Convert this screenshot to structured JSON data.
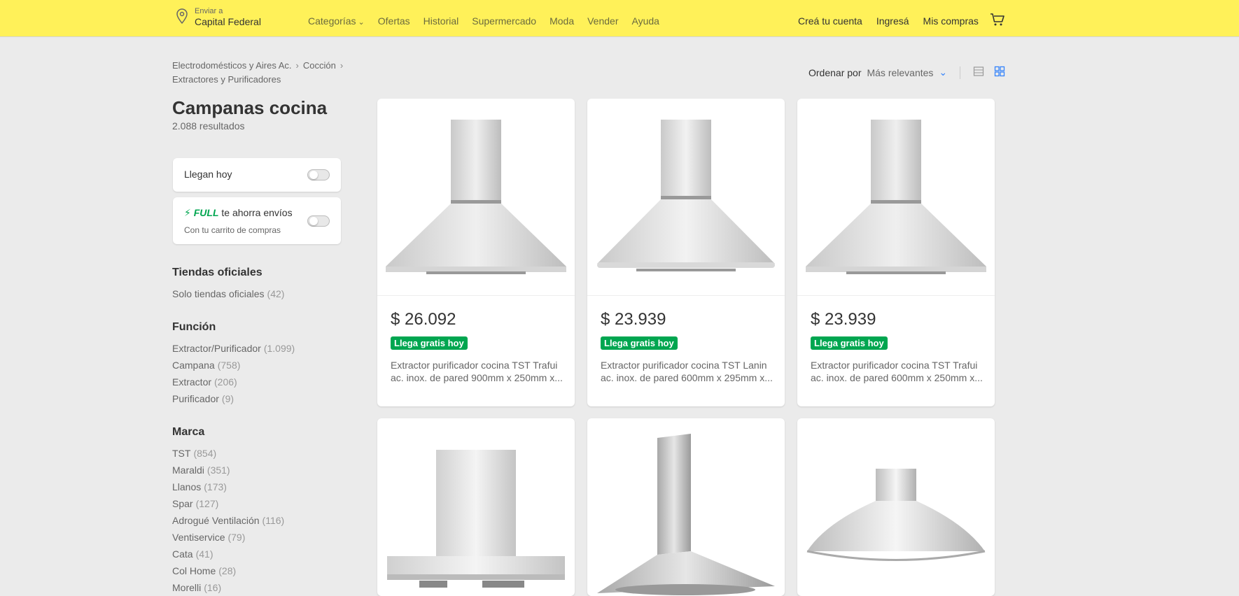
{
  "header": {
    "location_small": "Enviar a",
    "location_big": "Capital Federal",
    "nav": [
      "Categorías",
      "Ofertas",
      "Historial",
      "Supermercado",
      "Moda",
      "Vender",
      "Ayuda"
    ],
    "account": [
      "Creá tu cuenta",
      "Ingresá",
      "Mis compras"
    ]
  },
  "breadcrumbs": [
    "Electrodomésticos y Aires Ac.",
    "Cocción",
    "Extractores y Purificadores"
  ],
  "page": {
    "title": "Campanas cocina",
    "results": "2.088 resultados"
  },
  "filters": {
    "today": {
      "label": "Llegan hoy"
    },
    "full": {
      "brand": "FULL",
      "label": "te ahorra envíos",
      "sub": "Con tu carrito de compras"
    },
    "sections": [
      {
        "title": "Tiendas oficiales",
        "items": [
          {
            "label": "Solo tiendas oficiales",
            "count": "(42)"
          }
        ]
      },
      {
        "title": "Función",
        "items": [
          {
            "label": "Extractor/Purificador",
            "count": "(1.099)"
          },
          {
            "label": "Campana",
            "count": "(758)"
          },
          {
            "label": "Extractor",
            "count": "(206)"
          },
          {
            "label": "Purificador",
            "count": "(9)"
          }
        ]
      },
      {
        "title": "Marca",
        "items": [
          {
            "label": "TST",
            "count": "(854)"
          },
          {
            "label": "Maraldi",
            "count": "(351)"
          },
          {
            "label": "Llanos",
            "count": "(173)"
          },
          {
            "label": "Spar",
            "count": "(127)"
          },
          {
            "label": "Adrogué Ventilación",
            "count": "(116)"
          },
          {
            "label": "Ventiservice",
            "count": "(79)"
          },
          {
            "label": "Cata",
            "count": "(41)"
          },
          {
            "label": "Col Home",
            "count": "(28)"
          },
          {
            "label": "Morelli",
            "count": "(16)"
          }
        ]
      }
    ]
  },
  "sort": {
    "label": "Ordenar por",
    "value": "Más relevantes"
  },
  "products": [
    {
      "price": "$ 26.092",
      "shipping": "Llega gratis hoy",
      "title": "Extractor purificador cocina TST Trafui ac. inox. de pared 900mm x 250mm x..."
    },
    {
      "price": "$ 23.939",
      "shipping": "Llega gratis hoy",
      "title": "Extractor purificador cocina TST Lanin ac. inox. de pared 600mm x 295mm x..."
    },
    {
      "price": "$ 23.939",
      "shipping": "Llega gratis hoy",
      "title": "Extractor purificador cocina TST Trafui ac. inox. de pared 600mm x 250mm x..."
    },
    {
      "price": "",
      "shipping": "",
      "title": ""
    },
    {
      "price": "",
      "shipping": "",
      "title": ""
    },
    {
      "price": "",
      "shipping": "",
      "title": ""
    }
  ],
  "icons": {
    "location": "location-pin-icon",
    "cart": "cart-icon",
    "list_view": "list-view-icon",
    "grid_view": "grid-view-icon"
  },
  "colors": {
    "header_bg": "#fff159",
    "accent": "#3483fa",
    "shipping_green": "#00a650"
  }
}
